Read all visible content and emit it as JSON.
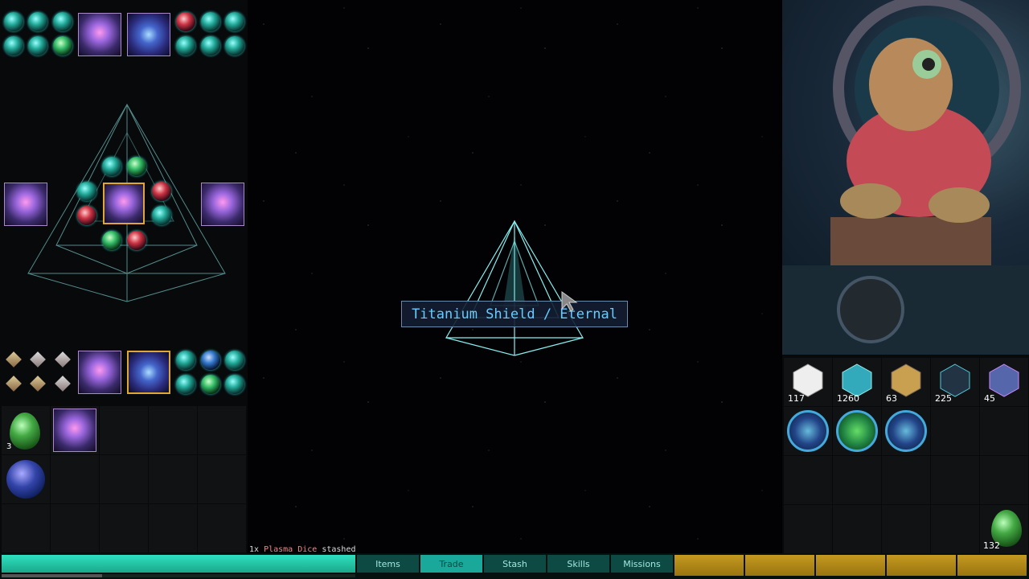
{
  "tooltip": {
    "text": "Titanium Shield / Eternal"
  },
  "notification": {
    "count": "1x",
    "item": "Plasma Dice",
    "action": "stashed"
  },
  "tabs": [
    {
      "label": "Items",
      "active": false
    },
    {
      "label": "Trade",
      "active": true
    },
    {
      "label": "Stash",
      "active": false
    },
    {
      "label": "Skills",
      "active": false
    },
    {
      "label": "Missions",
      "active": false
    }
  ],
  "left_inventory": {
    "egg_count": "3"
  },
  "right_inventory": {
    "dice": [
      {
        "name": "white-die",
        "count": "117"
      },
      {
        "name": "blue-crystal-die",
        "count": "1260"
      },
      {
        "name": "gold-die",
        "count": "63"
      },
      {
        "name": "cyber-cube-die",
        "count": "225"
      },
      {
        "name": "prism-die",
        "count": "45"
      }
    ],
    "egg_count": "132"
  }
}
